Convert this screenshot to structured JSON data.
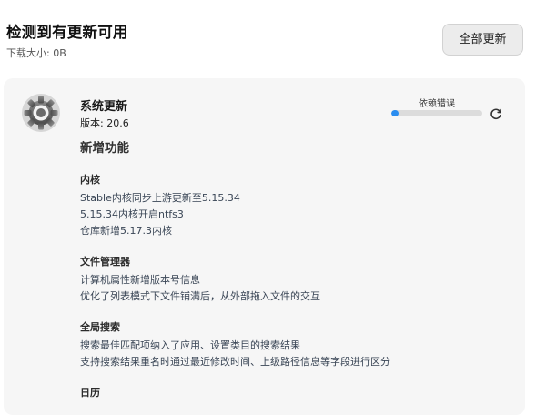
{
  "header": {
    "title": "检测到有更新可用",
    "download_size": "下载大小: 0B",
    "update_all_label": "全部更新"
  },
  "app": {
    "name": "系统更新",
    "version": "版本: 20.6",
    "icon": "gear-icon",
    "status_label": "依赖错误",
    "progress": 0.08,
    "retry_icon": "refresh-icon"
  },
  "features": {
    "title": "新增功能",
    "sections": [
      {
        "title": "内核",
        "items": [
          "Stable内核同步上游更新至5.15.34",
          "5.15.34内核开启ntfs3",
          "仓库新增5.17.3内核"
        ]
      },
      {
        "title": "文件管理器",
        "items": [
          "计算机属性新增版本号信息",
          "优化了列表模式下文件铺满后，从外部拖入文件的交互"
        ]
      },
      {
        "title": "全局搜索",
        "items": [
          "搜索最佳匹配项纳入了应用、设置类目的搜索结果",
          "支持搜索结果重名时通过最近修改时间、上级路径信息等字段进行区分"
        ]
      },
      {
        "title": "日历",
        "items": []
      }
    ]
  },
  "colors": {
    "accent": "#2a8df0",
    "card_bg": "#f6f6f6"
  }
}
